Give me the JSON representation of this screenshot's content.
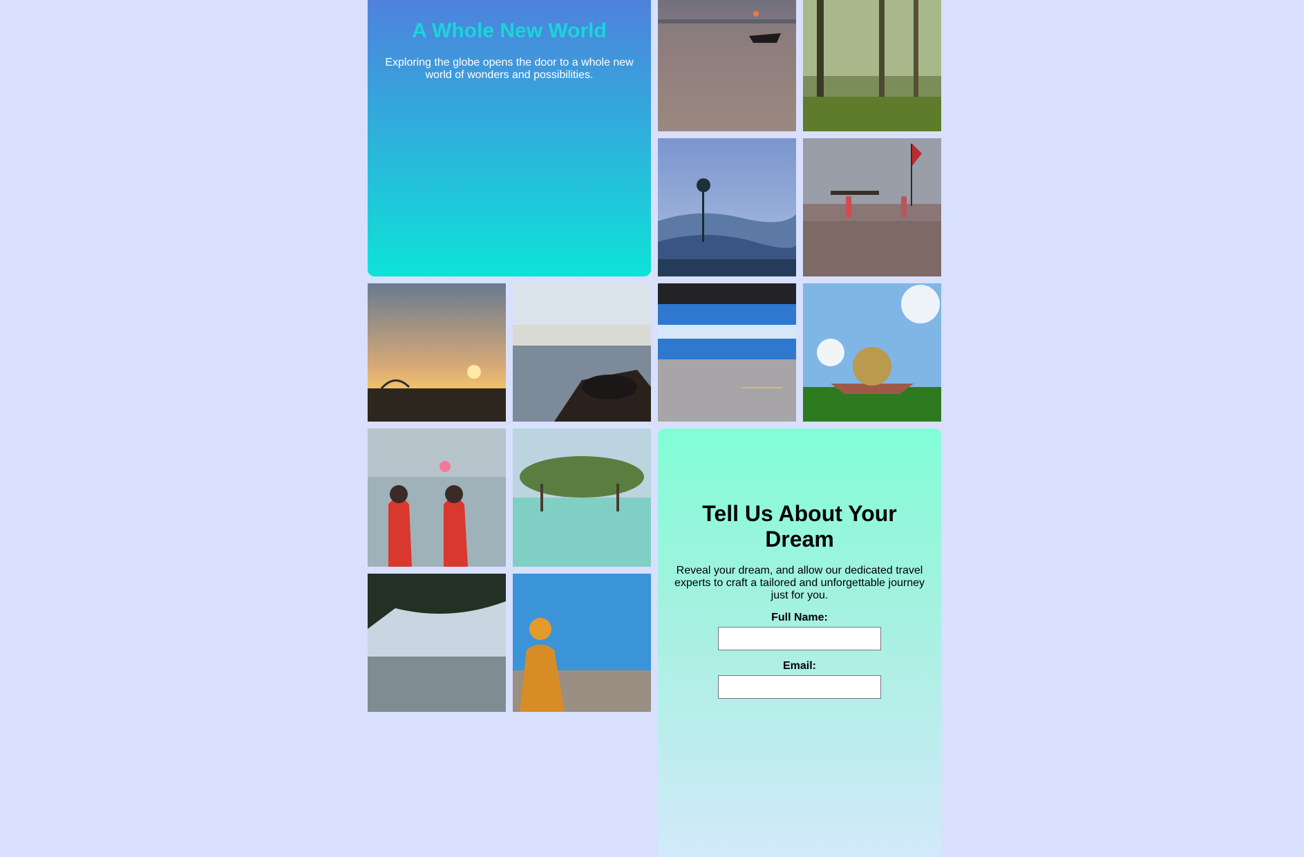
{
  "hero": {
    "title": "A Whole New World",
    "subtitle": "Exploring the globe opens the door to a whole new world of wonders and possibilities."
  },
  "photos": [
    {
      "name": "photo-boat-sunset",
      "subject": "boat at sunset on sea"
    },
    {
      "name": "photo-palm-grove",
      "subject": "palm trees in forest light"
    },
    {
      "name": "photo-misty-hills",
      "subject": "lone tree above misty blue hills"
    },
    {
      "name": "photo-beach-flag",
      "subject": "people carrying boat on beach with red flag"
    },
    {
      "name": "photo-sunset-shore",
      "subject": "sun setting over rocky shore"
    },
    {
      "name": "photo-lake-cow",
      "subject": "cow resting by lake with white town"
    },
    {
      "name": "photo-moving-train",
      "subject": "blue train in motion"
    },
    {
      "name": "photo-golden-dome",
      "subject": "golden dome on green lawn"
    },
    {
      "name": "photo-women-sea",
      "subject": "two women in red saris facing sea"
    },
    {
      "name": "photo-mangroves",
      "subject": "mangrove trees in turquoise water"
    },
    {
      "name": "photo-beach-tree",
      "subject": "beach under overhanging tree"
    },
    {
      "name": "photo-sadhu-wall",
      "subject": "man in orange by blue wall"
    }
  ],
  "form": {
    "title": "Tell Us About Your Dream",
    "description": "Reveal your dream, and allow our dedicated travel experts to craft a tailored and unforgettable journey just for you.",
    "name_label": "Full Name:",
    "email_label": "Email:"
  },
  "colors": {
    "background": "#d8e0fd",
    "hero_title": "#18d6da",
    "hero_gradient_top": "#517fdd",
    "hero_gradient_bottom": "#0ee3d8",
    "form_gradient_top": "#82fed6"
  }
}
